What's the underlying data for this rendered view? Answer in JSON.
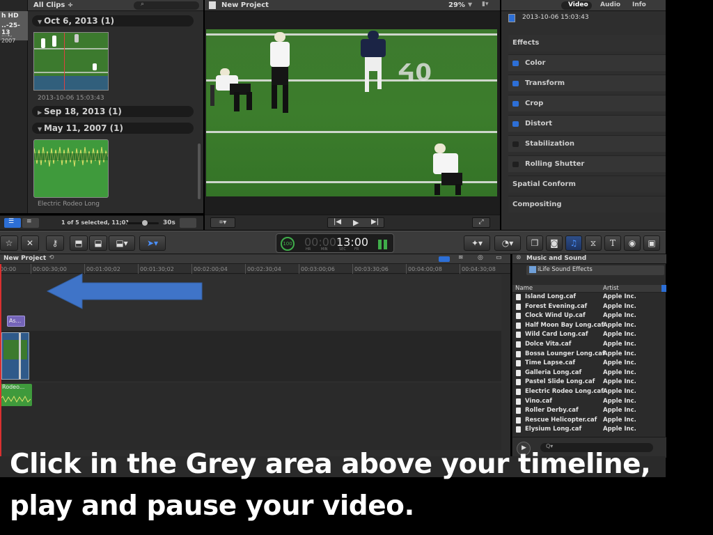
{
  "library": {
    "event_label_1": "h HD",
    "event_label_2": "..-25-13",
    "event_label_3": "...1, 2007"
  },
  "browser": {
    "filter_label": "All Clips ÷",
    "groups": [
      {
        "label": "Oct 6, 2013  (1)",
        "expanded": true,
        "clip_caption": "2013-10-06 15:03:43"
      },
      {
        "label": "Sep 18, 2013  (1)",
        "expanded": false
      },
      {
        "label": "May 11, 2007  (1)",
        "expanded": true,
        "clip_caption": "Electric Rodeo Long"
      }
    ],
    "status": "1 of 5 selected, 11;01",
    "duration": "30s"
  },
  "viewer": {
    "title": "New Project",
    "zoom": "29%"
  },
  "inspector": {
    "tabs": [
      "Video",
      "Audio",
      "Info"
    ],
    "clip_name": "2013-10-06 15:03:43",
    "effects_header": "Effects",
    "rows": [
      {
        "label": "Color",
        "enabled": true
      },
      {
        "label": "Transform",
        "enabled": true
      },
      {
        "label": "Crop",
        "enabled": true
      },
      {
        "label": "Distort",
        "enabled": true
      },
      {
        "label": "Stabilization",
        "enabled": false
      },
      {
        "label": "Rolling Shutter",
        "enabled": false
      }
    ],
    "spatial_conform": "Spatial Conform",
    "compositing": "Compositing"
  },
  "toolbar": {
    "percent": "100",
    "timecode_hidden": "00:00:",
    "timecode": "13:00",
    "timecode_units": [
      "HR",
      "MIN",
      "SEC",
      "FR"
    ],
    "title_tool": "T"
  },
  "timeline": {
    "project_name": "New Project",
    "ruler": [
      "00:00",
      "00:00:30;00",
      "00:01:00;02",
      "00:01:30;02",
      "00:02:00;04",
      "00:02:30;04",
      "00:03:00;06",
      "00:03:30;06",
      "00:04:00;08",
      "00:04:30;08"
    ],
    "title_clip": "As...",
    "audio_clip": "Rodeo..."
  },
  "music": {
    "title": "Music and Sound",
    "folder": "iLife Sound Effects",
    "columns": {
      "name": "Name",
      "artist": "Artist"
    },
    "items": [
      {
        "name": "Island Long.caf",
        "artist": "Apple Inc."
      },
      {
        "name": "Forest Evening.caf",
        "artist": "Apple Inc."
      },
      {
        "name": "Clock Wind Up.caf",
        "artist": "Apple Inc."
      },
      {
        "name": "Half Moon Bay Long.caf",
        "artist": "Apple Inc."
      },
      {
        "name": "Wild Card Long.caf",
        "artist": "Apple Inc."
      },
      {
        "name": "Dolce Vita.caf",
        "artist": "Apple Inc."
      },
      {
        "name": "Bossa Lounger Long.caf",
        "artist": "Apple Inc."
      },
      {
        "name": "Time Lapse.caf",
        "artist": "Apple Inc."
      },
      {
        "name": "Galleria Long.caf",
        "artist": "Apple Inc."
      },
      {
        "name": "Pastel Slide Long.caf",
        "artist": "Apple Inc."
      },
      {
        "name": "Electric Rodeo Long.caf",
        "artist": "Apple Inc."
      },
      {
        "name": "Vino.caf",
        "artist": "Apple Inc."
      },
      {
        "name": "Roller Derby.caf",
        "artist": "Apple Inc."
      },
      {
        "name": "Rescue Helicopter.caf",
        "artist": "Apple Inc."
      },
      {
        "name": "Elysium Long.caf",
        "artist": "Apple Inc."
      }
    ],
    "search_placeholder": "Q▾"
  },
  "caption": {
    "line1": "Click in the Grey area above your timeline,",
    "line2": "play and pause your video."
  },
  "colors": {
    "accent_blue": "#2d6fd6",
    "arrow_blue": "#3f74c8",
    "timecode_green": "#3fae4a",
    "field_green": "#3b7a2d"
  }
}
